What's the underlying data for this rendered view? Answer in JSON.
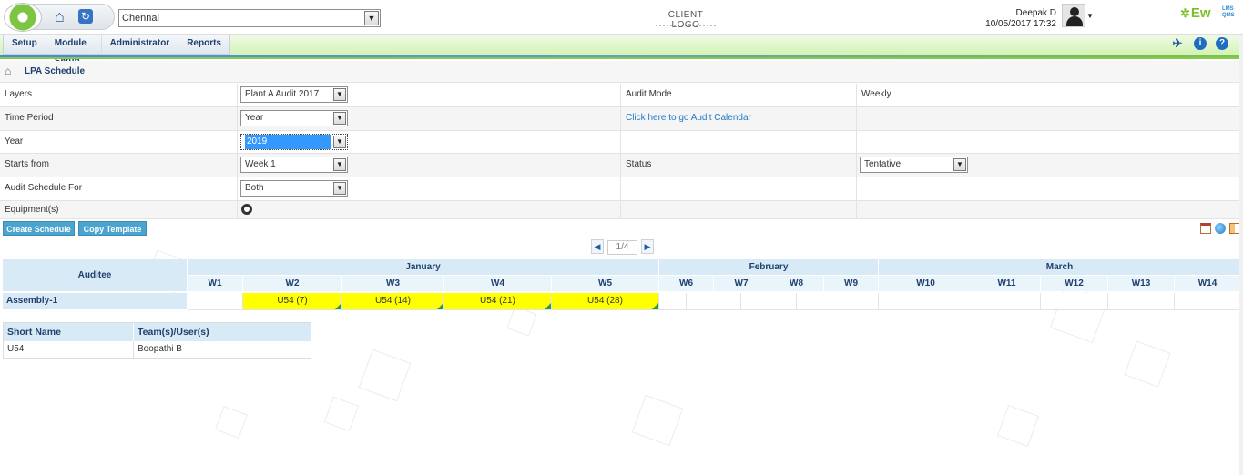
{
  "header": {
    "location_select": "Chennai",
    "client_logo": "CLIENT LOGO",
    "user_name": "Deepak D",
    "user_datetime": "10/05/2017 17:32",
    "brand": "Ew",
    "brand_sub_top": "LMS",
    "brand_sub_bottom": "QMS"
  },
  "menu": {
    "items": [
      "Setup",
      "Module Setup",
      "Administrator",
      "Reports"
    ]
  },
  "breadcrumb": {
    "title": "LPA Schedule"
  },
  "form": {
    "layers_label": "Layers",
    "layers_value": "Plant A Audit 2017",
    "audit_mode_label": "Audit Mode",
    "audit_mode_value": "Weekly",
    "time_period_label": "Time Period",
    "time_period_value": "Year",
    "calendar_link": "Click here to go Audit Calendar",
    "year_label": "Year",
    "year_value": "2019",
    "starts_from_label": "Starts from",
    "starts_from_value": "Week 1",
    "status_label": "Status",
    "status_value": "Tentative",
    "schedule_for_label": "Audit Schedule For",
    "schedule_for_value": "Both",
    "equipment_label": "Equipment(s)"
  },
  "buttons": {
    "create_schedule": "Create Schedule",
    "copy_template": "Copy Template"
  },
  "pager": {
    "page": "1/4"
  },
  "schedule": {
    "auditee_header": "Auditee",
    "months": [
      "January",
      "February",
      "March"
    ],
    "weeks": [
      "W1",
      "W2",
      "W3",
      "W4",
      "W5",
      "W6",
      "W7",
      "W8",
      "W9",
      "W10",
      "W11",
      "W12",
      "W13",
      "W14"
    ],
    "rows": [
      {
        "auditee": "Assembly-1",
        "cells": [
          "",
          "U54 (7)",
          "U54 (14)",
          "U54 (21)",
          "U54 (28)",
          "",
          "",
          "",
          "",
          "",
          "",
          "",
          "",
          ""
        ]
      }
    ]
  },
  "legend": {
    "headers": [
      "Short Name",
      "Team(s)/User(s)"
    ],
    "rows": [
      {
        "short": "U54",
        "users": "Boopathi B"
      }
    ]
  },
  "colors": {
    "scheduled_cell": "#ffff00",
    "header_blue": "#d8eaf6",
    "button_blue": "#49a4cf",
    "menu_green": "#d4f3b5"
  }
}
